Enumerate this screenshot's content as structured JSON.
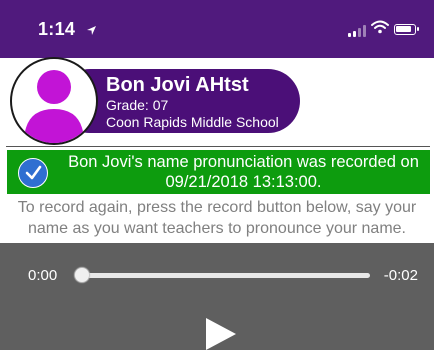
{
  "status_bar": {
    "time": "1:14",
    "icons": [
      "location-arrow-icon",
      "cellular-signal-icon",
      "wifi-icon",
      "battery-icon"
    ]
  },
  "profile": {
    "name": "Bon Jovi AHtst",
    "grade": "Grade: 07",
    "school": "Coon Rapids Middle School"
  },
  "banner": {
    "message": "Bon Jovi's name pronunciation was recorded on 09/21/2018 13:13:00."
  },
  "instructions": "To record again, press the record button below, say your name as you want teachers to pronounce your name.",
  "player": {
    "current_time": "0:00",
    "remaining_time": "-0:02",
    "progress": 0
  },
  "colors": {
    "header_purple": "#501a7d",
    "profile_purple": "#4b0f78",
    "avatar_magenta": "#c214d6",
    "success_green": "#0d9c0e",
    "check_blue": "#2f6fd1",
    "player_gray": "#5f5f5f"
  }
}
